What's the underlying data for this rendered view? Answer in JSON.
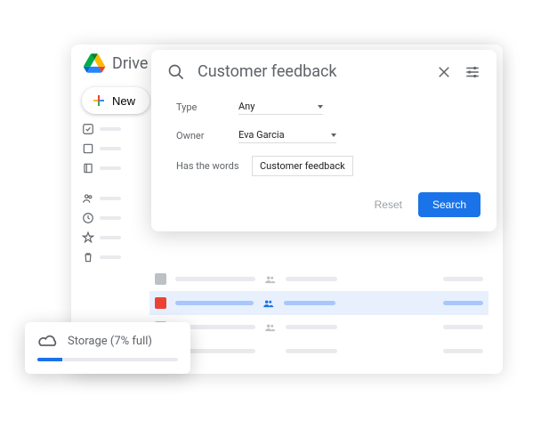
{
  "header": {
    "app_name": "Drive"
  },
  "new_button": {
    "label": "New"
  },
  "search": {
    "query": "Customer feedback",
    "filters": {
      "type": {
        "label": "Type",
        "value": "Any"
      },
      "owner": {
        "label": "Owner",
        "value": "Eva Garcia"
      },
      "has_words": {
        "label": "Has the words",
        "value": "Customer feedback"
      }
    },
    "reset_label": "Reset",
    "search_label": "Search"
  },
  "storage": {
    "label": "Storage (7% full)",
    "percent": 7
  },
  "colors": {
    "accent": "#1a73e8",
    "muted": "#5f6368",
    "placeholder": "#e8eaed"
  }
}
